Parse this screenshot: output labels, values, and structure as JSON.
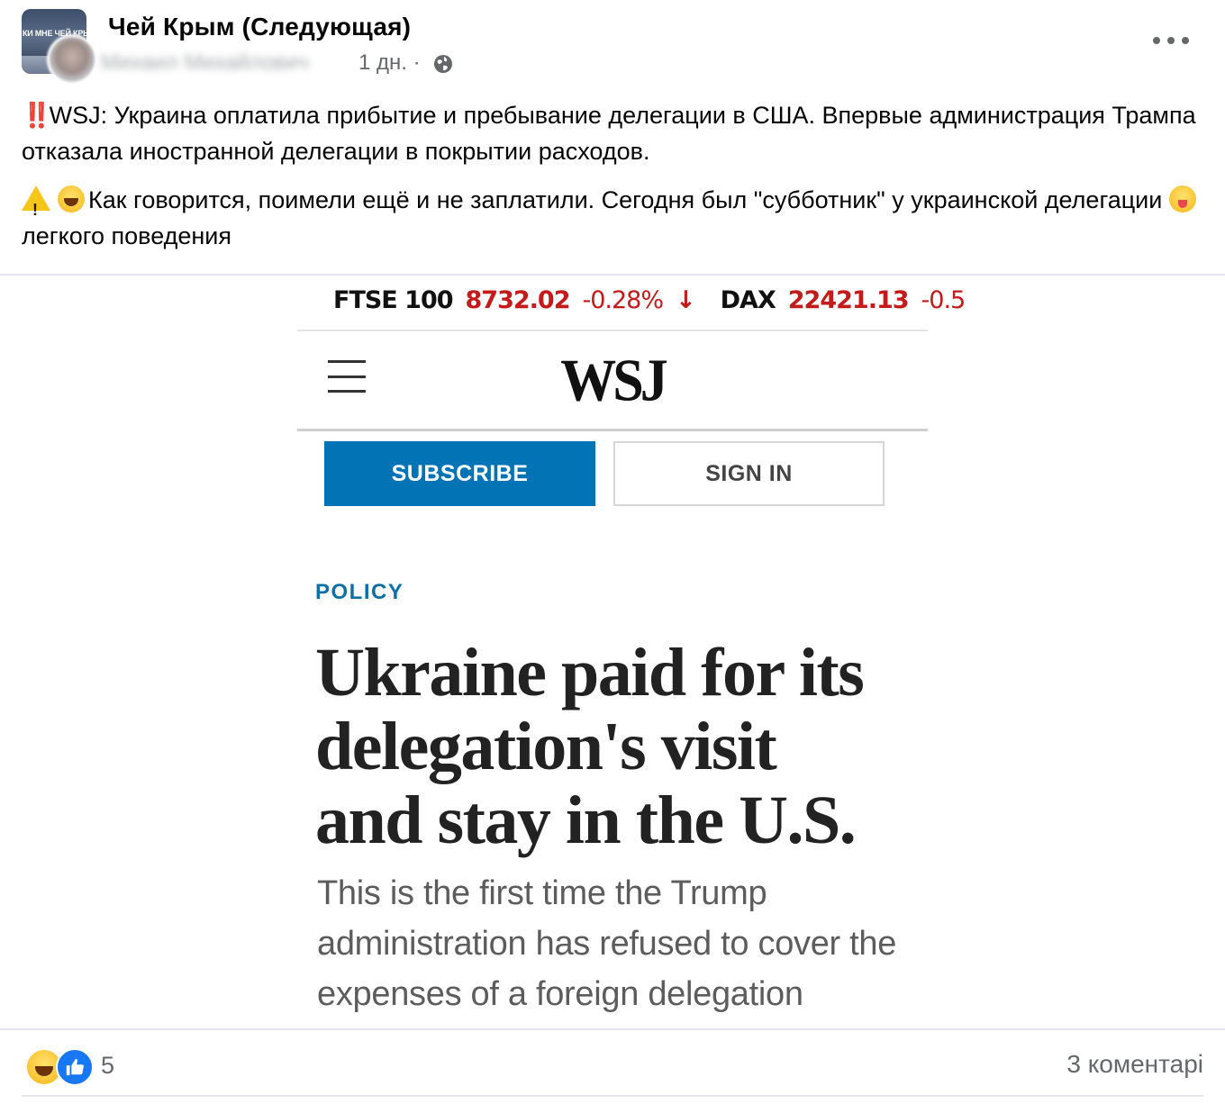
{
  "header": {
    "group_name": "Чей Крым  (Следующая)",
    "group_avatar_text": "КИ МНЕ ЧЕЙ КРЫ СКАЖ",
    "author_name": "Михаил Михайлович",
    "timestamp": "1 дн. ·",
    "icons": {
      "privacy": "globe-icon",
      "more": "more-icon"
    }
  },
  "post_text": {
    "p1_emoji": "‼️",
    "p1_text": "WSJ: Украина оплатила прибытие и пребывание делегации в США. Впервые администрация Трампа отказала иностранной делегации в покрытии расходов.",
    "p2_text_a": "Как говорится, поимели ещё и не заплатили. Сегодня был \"субботник\" у украинской делегации ",
    "p2_text_b": "легкого поведения"
  },
  "wsj": {
    "ticker": {
      "ftse_name": "FTSE 100",
      "ftse_value": "8732.02",
      "ftse_change": "-0.28%",
      "ftse_arrow": "↓",
      "dax_name": "DAX",
      "dax_value": "22421.13",
      "dax_change": "-0.5"
    },
    "logo": "WSJ",
    "subscribe_label": "SUBSCRIBE",
    "signin_label": "SIGN IN",
    "section": "POLICY",
    "headline": "Ukraine paid for its delegation's visit and stay in the U.S.",
    "dek": "This is the first time the Trump administration has refused to cover the expenses of a foreign delegation",
    "colors": {
      "accent": "#0274b6",
      "negative": "#c41a1a",
      "section": "#0d6fa6"
    }
  },
  "footer": {
    "reaction_count": "5",
    "comments": "3 коментарі",
    "reaction_icons": [
      "haha-icon",
      "like-icon"
    ]
  }
}
